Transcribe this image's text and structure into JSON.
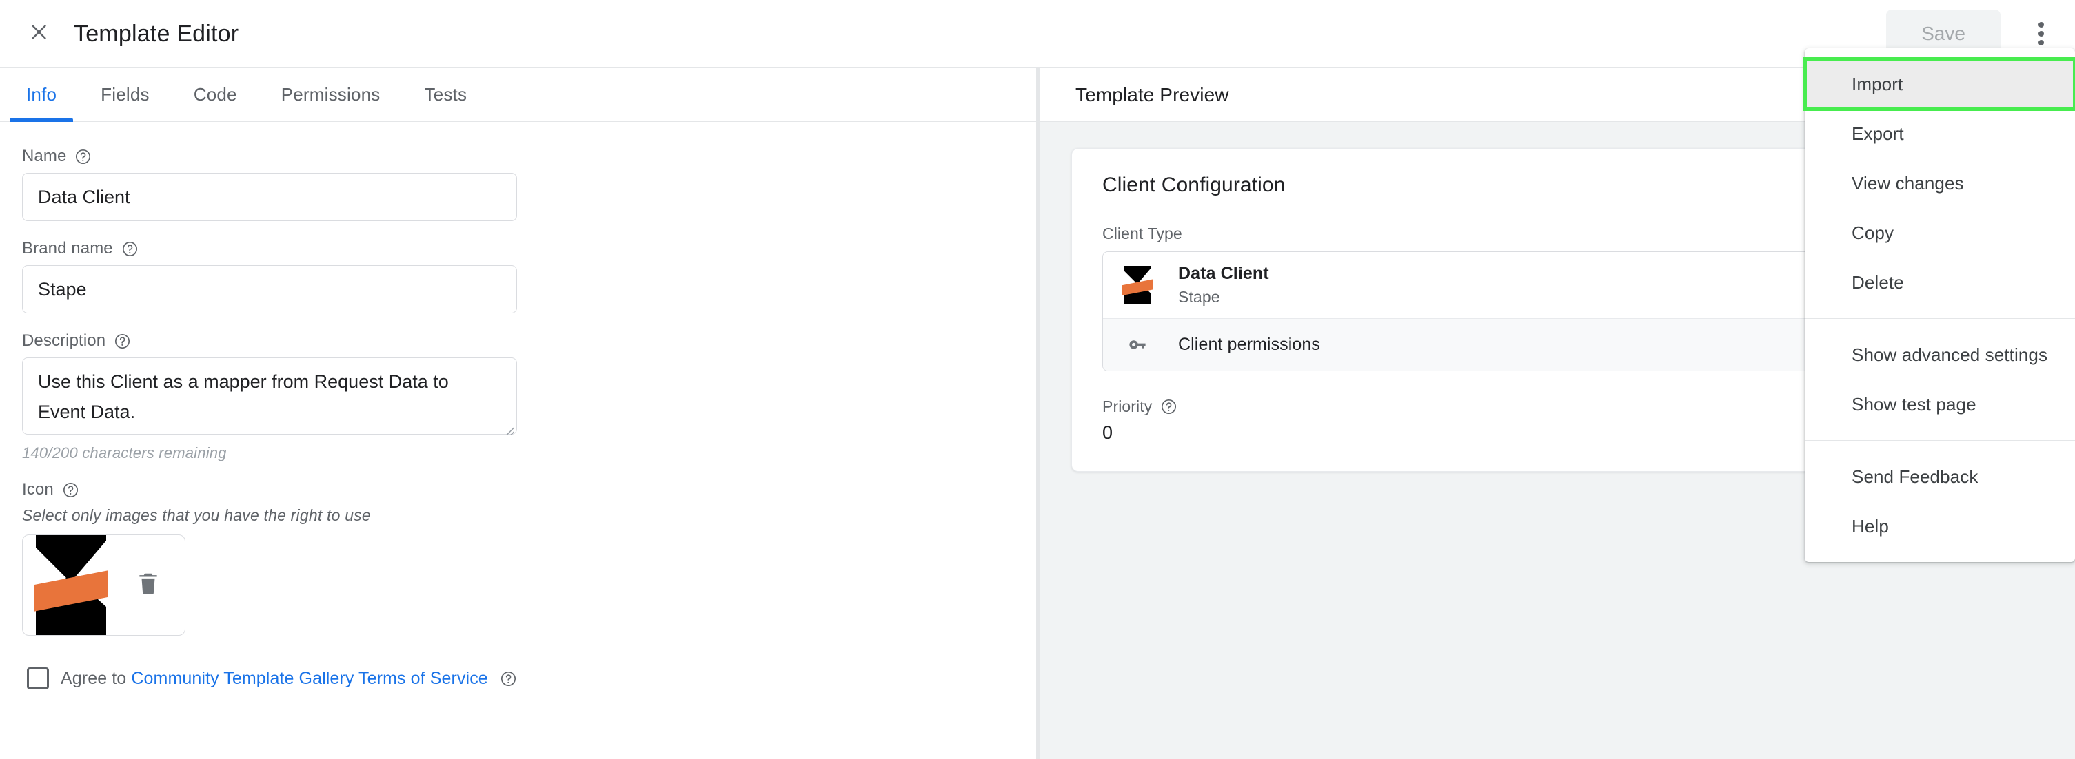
{
  "header": {
    "close_icon": "close-icon",
    "title": "Template Editor",
    "save_label": "Save",
    "more_icon": "more-vert-icon"
  },
  "tabs": [
    {
      "label": "Info",
      "active": true
    },
    {
      "label": "Fields",
      "active": false
    },
    {
      "label": "Code",
      "active": false
    },
    {
      "label": "Permissions",
      "active": false
    },
    {
      "label": "Tests",
      "active": false
    }
  ],
  "form": {
    "name": {
      "label": "Name",
      "value": "Data Client",
      "help_icon": "help-circle-icon"
    },
    "brand_name": {
      "label": "Brand name",
      "value": "Stape",
      "help_icon": "help-circle-icon"
    },
    "description": {
      "label": "Description",
      "value": "Use this Client as a mapper from Request Data to Event Data.",
      "counter": "140/200 characters remaining",
      "help_icon": "help-circle-icon"
    },
    "icon": {
      "label": "Icon",
      "help_icon": "help-circle-icon",
      "hint": "Select only images that you have the right to use",
      "image_name": "stape-logo",
      "delete_icon": "trash-icon"
    },
    "agree": {
      "prefix": "Agree to ",
      "link": "Community Template Gallery Terms of Service",
      "checked": false,
      "help_icon": "help-circle-icon"
    }
  },
  "preview": {
    "header": "Template Preview",
    "card_title": "Client Configuration",
    "client_type_label": "Client Type",
    "client": {
      "name": "Data Client",
      "brand": "Stape",
      "icon": "stape-logo"
    },
    "permissions": {
      "label": "Client permissions",
      "icon": "key-icon"
    },
    "priority": {
      "label": "Priority",
      "value": "0",
      "help_icon": "help-circle-icon"
    }
  },
  "menu": {
    "items": [
      {
        "label": "Import",
        "highlighted": true,
        "divider_after": false
      },
      {
        "label": "Export",
        "highlighted": false,
        "divider_after": false
      },
      {
        "label": "View changes",
        "highlighted": false,
        "divider_after": false
      },
      {
        "label": "Copy",
        "highlighted": false,
        "divider_after": false
      },
      {
        "label": "Delete",
        "highlighted": false,
        "divider_after": true
      },
      {
        "label": "Show advanced settings",
        "highlighted": false,
        "divider_after": false
      },
      {
        "label": "Show test page",
        "highlighted": false,
        "divider_after": true
      },
      {
        "label": "Send Feedback",
        "highlighted": false,
        "divider_after": false
      },
      {
        "label": "Help",
        "highlighted": false,
        "divider_after": false
      }
    ]
  },
  "colors": {
    "accent_blue": "#1a73e8",
    "highlight_green": "#48ec4f",
    "brand_orange": "#e8743b",
    "panel_bg": "#f1f3f4",
    "text_primary": "#202124",
    "text_secondary": "#5f6368"
  }
}
